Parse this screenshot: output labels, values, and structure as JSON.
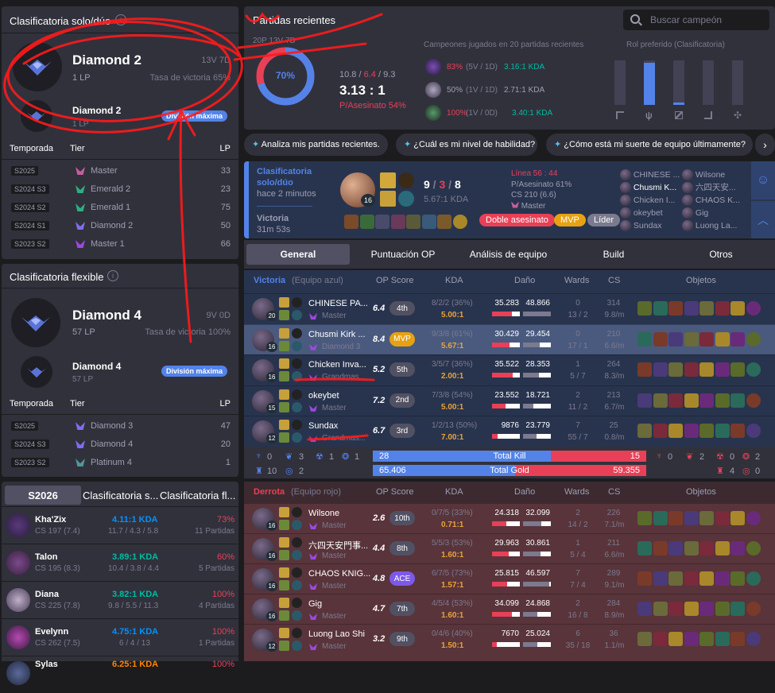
{
  "solo": {
    "title": "Clasificatoria solo/dúo",
    "tier": "Diamond 2",
    "wl": "13V 7D",
    "lp": "1 LP",
    "winrate": "Tasa de victoria 65%",
    "peak_tier": "Diamond 2",
    "peak_lp": "1 LP",
    "peak_badge": "División máxima",
    "headers": {
      "season": "Temporada",
      "tier": "Tier",
      "lp": "LP"
    },
    "seasons": [
      {
        "s": "S2025",
        "tier": "Master",
        "lp": "33",
        "color": "#9d48e0"
      },
      {
        "s": "S2024 S3",
        "tier": "Emerald 2",
        "lp": "23",
        "color": "#2daf7f"
      },
      {
        "s": "S2024 S2",
        "tier": "Emerald 1",
        "lp": "75",
        "color": "#2daf7f"
      },
      {
        "s": "S2024 S1",
        "tier": "Diamond 2",
        "lp": "50",
        "color": "#7d6ef0"
      },
      {
        "s": "S2023 S2",
        "tier": "Master 1",
        "lp": "66",
        "color": "#9d48e0"
      }
    ]
  },
  "flex": {
    "title": "Clasificatoria flexible",
    "tier": "Diamond 4",
    "wl": "9V 0D",
    "lp": "57 LP",
    "winrate": "Tasa de victoria 100%",
    "peak_tier": "Diamond 4",
    "peak_lp": "57 LP",
    "peak_badge": "División máxima",
    "headers": {
      "season": "Temporada",
      "tier": "Tier",
      "lp": "LP"
    },
    "seasons": [
      {
        "s": "S2025",
        "tier": "Diamond 3",
        "lp": "47"
      },
      {
        "s": "S2024 S3",
        "tier": "Diamond 4",
        "lp": "20"
      },
      {
        "s": "S2023 S2",
        "tier": "Platinum 4",
        "lp": "1"
      }
    ]
  },
  "champ_tabs": {
    "t1": "S2026",
    "t2": "Clasificatoria s...",
    "t3": "Clasificatoria fl..."
  },
  "champs": [
    {
      "name": "Kha'Zix",
      "cs": "CS 197 (7.4)",
      "kda": "4.11:1 KDA",
      "kda_sub": "11.7 / 4.3 / 5.8",
      "wr": "73%",
      "games": "11 Partidas",
      "kcolor": "#0093ff"
    },
    {
      "name": "Talon",
      "cs": "CS 195 (8.3)",
      "kda": "3.89:1 KDA",
      "kda_sub": "10.4 / 3.8 / 4.4",
      "wr": "60%",
      "games": "5 Partidas",
      "kcolor": "#00bba3"
    },
    {
      "name": "Diana",
      "cs": "CS 225 (7.8)",
      "kda": "3.82:1 KDA",
      "kda_sub": "9.8 / 5.5 / 11.3",
      "wr": "100%",
      "games": "4 Partidas",
      "kcolor": "#00bba3"
    },
    {
      "name": "Evelynn",
      "cs": "CS 262 (7.5)",
      "kda": "4.75:1 KDA",
      "kda_sub": "6 / 4 / 13",
      "wr": "100%",
      "games": "1 Partidas",
      "kcolor": "#0093ff"
    },
    {
      "name": "Sylas",
      "cs": "",
      "kda": "6.25:1 KDA",
      "kda_sub": "",
      "wr": "100%",
      "games": "",
      "kcolor": "#ff8200"
    }
  ],
  "recent": {
    "title": "Partidas recientes",
    "search_placeholder": "Buscar campeón",
    "gp": "20P 13V 7D",
    "donut": "70%",
    "kda_line": {
      "k": "10.8",
      "d": "6.4",
      "a": "9.3"
    },
    "ratio": "3.13 : 1",
    "kp": "P/Asesinato 54%",
    "champs_title": "Campeones jugados en 20 partidas recientes",
    "champs": [
      {
        "wr": "83%",
        "rec": "(5V / 1D)",
        "kda": "3.16:1 KDA"
      },
      {
        "wr": "50%",
        "rec": "(1V / 1D)",
        "kda": "2.71:1 KDA"
      },
      {
        "wr": "100%",
        "rec": "(1V / 0D)",
        "kda": "3.40:1 KDA"
      }
    ],
    "role_title": "Rol preferido (Clasificatoria)",
    "roles": [
      0,
      0.95,
      0.05,
      0,
      0
    ]
  },
  "prompts": [
    "Analiza mis partidas recientes.",
    "¿Cuál es mi nivel de habilidad?",
    "¿Cómo está mi suerte de equipo últimamente?"
  ],
  "match": {
    "queue": "Clasificatoria solo/dúo",
    "ago": "hace 2 minutos",
    "result": "Victoria",
    "duration": "31m 53s",
    "level": "16",
    "k": "9",
    "d": "3",
    "a": "8",
    "kda": "5.67:1 KDA",
    "line": "Línea 56 : 44",
    "kp": "P/Asesinato 61%",
    "cs": "CS 210 (6.6)",
    "rank": "Master",
    "badges": [
      "Doble asesinato",
      "MVP",
      "Líder"
    ],
    "team_a": [
      "CHINESE ...",
      "Chusmi K...",
      "Chicken I...",
      "okeybet",
      "Sundax"
    ],
    "team_b": [
      "Wilsone",
      "六四天安...",
      "CHAOS K...",
      "Gig",
      "Luong La..."
    ]
  },
  "tabs": [
    "General",
    "Puntuación OP",
    "Análisis de equipo",
    "Build",
    "Otros"
  ],
  "win_team": {
    "label": "Victoria",
    "side": "(Equipo azul)",
    "cols": {
      "op": "OP Score",
      "kda": "KDA",
      "dmg": "Daño",
      "wards": "Wards",
      "cs": "CS",
      "items": "Objetos"
    },
    "players": [
      {
        "name": "CHINESE PA...",
        "rank": "Master",
        "lvl": "20",
        "score": "6.4",
        "pos": "4th",
        "kda": "8/2/2 (36%)",
        "ratio": "5.00:1",
        "dmg1": "35.283",
        "dmg2": "48.866",
        "d1": 0.72,
        "d2": 1.0,
        "wards": "0",
        "wards2": "13 / 2",
        "cs": "314",
        "cspm": "9.8/m",
        "hl": false
      },
      {
        "name": "Chusmi Kirk ...",
        "rank": "Diamond 3",
        "lvl": "16",
        "score": "8.4",
        "pos": "MVP",
        "kda": "9/3/8 (61%)",
        "ratio": "5.67:1",
        "dmg1": "30.429",
        "dmg2": "29.454",
        "d1": 0.62,
        "d2": 0.6,
        "wards": "0",
        "wards2": "17 / 1",
        "cs": "210",
        "cspm": "6.6/m",
        "hl": true
      },
      {
        "name": "Chicken Inva...",
        "rank": "Grandmas...",
        "lvl": "16",
        "score": "5.2",
        "pos": "5th",
        "kda": "3/5/7 (36%)",
        "ratio": "2.00:1",
        "dmg1": "35.522",
        "dmg2": "28.353",
        "d1": 0.73,
        "d2": 0.58,
        "wards": "1",
        "wards2": "5 / 7",
        "cs": "264",
        "cspm": "8.3/m",
        "hl": false
      },
      {
        "name": "okeybet",
        "rank": "Master",
        "lvl": "15",
        "score": "7.2",
        "pos": "2nd",
        "kda": "7/3/8 (54%)",
        "ratio": "5.00:1",
        "dmg1": "23.552",
        "dmg2": "18.721",
        "d1": 0.48,
        "d2": 0.38,
        "wards": "2",
        "wards2": "11 / 2",
        "cs": "213",
        "cspm": "6.7/m",
        "hl": false
      },
      {
        "name": "Sundax",
        "rank": "Grandmas...",
        "lvl": "12",
        "score": "6.7",
        "pos": "3rd",
        "kda": "1/2/13 (50%)",
        "ratio": "7.00:1",
        "dmg1": "9876",
        "dmg2": "23.779",
        "d1": 0.2,
        "d2": 0.49,
        "wards": "7",
        "wards2": "55 / 7",
        "cs": "25",
        "cspm": "0.8/m",
        "hl": false
      }
    ]
  },
  "objectives": {
    "left": [
      "0",
      "3",
      "1",
      "1",
      "10",
      "2"
    ],
    "right": [
      "0",
      "2",
      "0",
      "2",
      "4",
      "0"
    ],
    "kills_l": "28",
    "kills_label": "Total Kill",
    "kills_r": "15",
    "kill_frac": 0.65,
    "gold_l": "65.406",
    "gold_label": "Total Gold",
    "gold_r": "59.355",
    "gold_frac": 0.52
  },
  "lose_team": {
    "label": "Derrota",
    "side": "(Equipo rojo)",
    "cols": {
      "op": "OP Score",
      "kda": "KDA",
      "dmg": "Daño",
      "wards": "Wards",
      "cs": "CS",
      "items": "Objetos"
    },
    "players": [
      {
        "name": "Wilsone",
        "rank": "Master",
        "lvl": "16",
        "score": "2.6",
        "pos": "10th",
        "kda": "0/7/5 (33%)",
        "ratio": "0.71:1",
        "dmg1": "24.318",
        "dmg2": "32.099",
        "d1": 0.5,
        "d2": 0.66,
        "wards": "2",
        "wards2": "14 / 2",
        "cs": "226",
        "cspm": "7.1/m"
      },
      {
        "name": "六四天安門事...",
        "rank": "Master",
        "lvl": "16",
        "score": "4.4",
        "pos": "8th",
        "kda": "5/5/3 (53%)",
        "ratio": "1.60:1",
        "dmg1": "29.963",
        "dmg2": "30.861",
        "d1": 0.61,
        "d2": 0.63,
        "wards": "1",
        "wards2": "5 / 4",
        "cs": "211",
        "cspm": "6.6/m"
      },
      {
        "name": "CHAOS KNIG...",
        "rank": "Master",
        "lvl": "16",
        "score": "4.8",
        "pos": "ACE",
        "kda": "6/7/5 (73%)",
        "ratio": "1.57:1",
        "dmg1": "25.815",
        "dmg2": "46.597",
        "d1": 0.53,
        "d2": 0.95,
        "wards": "7",
        "wards2": "7 / 4",
        "cs": "289",
        "cspm": "9.1/m"
      },
      {
        "name": "Gig",
        "rank": "Master",
        "lvl": "16",
        "score": "4.7",
        "pos": "7th",
        "kda": "4/5/4 (53%)",
        "ratio": "1.60:1",
        "dmg1": "34.099",
        "dmg2": "24.868",
        "d1": 0.7,
        "d2": 0.51,
        "wards": "2",
        "wards2": "16 / 8",
        "cs": "284",
        "cspm": "8.9/m"
      },
      {
        "name": "Luong Lao Shi",
        "rank": "Master",
        "lvl": "12",
        "score": "3.2",
        "pos": "9th",
        "kda": "0/4/6 (40%)",
        "ratio": "1.50:1",
        "dmg1": "7670",
        "dmg2": "25.024",
        "d1": 0.16,
        "d2": 0.51,
        "wards": "6",
        "wards2": "35 / 18",
        "cs": "36",
        "cspm": "1.1/m"
      }
    ]
  }
}
